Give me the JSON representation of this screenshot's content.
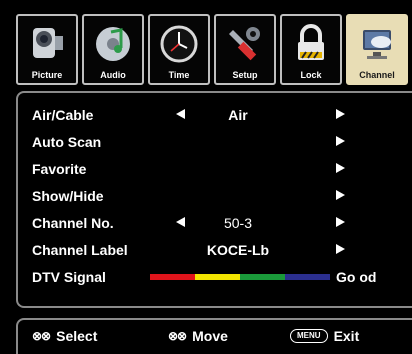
{
  "tabs": [
    {
      "label": "Picture",
      "icon": "camcorder-icon",
      "active": false
    },
    {
      "label": "Audio",
      "icon": "music-disc-icon",
      "active": false
    },
    {
      "label": "Time",
      "icon": "clock-icon",
      "active": false
    },
    {
      "label": "Setup",
      "icon": "tools-icon",
      "active": false
    },
    {
      "label": "Lock",
      "icon": "padlock-icon",
      "active": false
    },
    {
      "label": "Channel",
      "icon": "satellite-dish-icon",
      "active": true
    }
  ],
  "menu": {
    "air_cable": {
      "label": "Air/Cable",
      "value": "Air"
    },
    "auto_scan": {
      "label": "Auto Scan"
    },
    "favorite": {
      "label": "Favorite"
    },
    "show_hide": {
      "label": "Show/Hide"
    },
    "channel_no": {
      "label": "Channel No.",
      "value": "50-3"
    },
    "channel_label": {
      "label": "Channel Label",
      "value": "KOCE-Lb"
    },
    "dtv_signal": {
      "label": "DTV Signal",
      "quality": "Go od",
      "colors": [
        "#e0141b",
        "#f2e500",
        "#1a9a3a",
        "#2b2f8f"
      ]
    }
  },
  "help": {
    "select": {
      "glyph": "⊗⊗",
      "label": "Select"
    },
    "move": {
      "glyph": "⊗⊗",
      "label": "Move"
    },
    "exit": {
      "key": "MENU",
      "label": "Exit"
    }
  }
}
